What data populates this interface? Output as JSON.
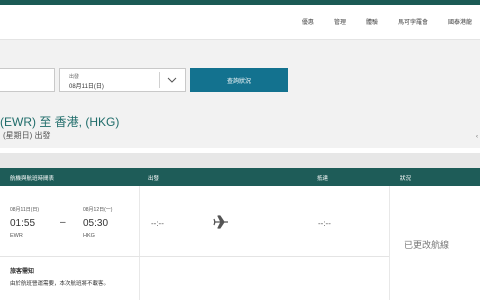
{
  "nav": {
    "items": [
      "優惠",
      "管理",
      "體驗",
      "馬可孛羅會",
      "國泰港龍"
    ]
  },
  "search": {
    "date_caption": "出發",
    "date_value": "08月11日(日)",
    "search_button": "查詢狀況"
  },
  "route": {
    "title": "(EWR) 至 香港, (HKG)",
    "subtitle": "(星期日) 出發"
  },
  "table": {
    "headers": {
      "flight": "航機與航班時間表",
      "departure": "出發",
      "arrival": "抵達",
      "status": "狀況"
    }
  },
  "flight": {
    "dep_date": "08月11日(日)",
    "dep_time": "01:55",
    "dep_code": "EWR",
    "dash": "–",
    "arr_date": "08月12日(一)",
    "arr_time": "05:30",
    "arr_code": "HKG",
    "dep_actual": "--:--",
    "arr_actual": "--:--",
    "status": "已更改航線"
  },
  "notice": {
    "title": "旅客需知",
    "text": "由於航班營運需要，本次航班將不載客。"
  },
  "colors": {
    "brand_green": "#1e5c58",
    "button_teal": "#13728f",
    "route_text": "#1f6c6a"
  }
}
